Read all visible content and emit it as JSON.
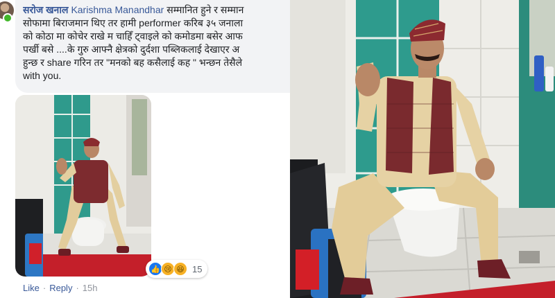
{
  "comment": {
    "author": "सरोज खनाल",
    "mention": "Karishma Manandhar",
    "lines": [
      "सम्मानित हुने र सम्मान",
      "सोफामा बिराजमान थिए तर हामी performer करिब ३५ जनाला",
      "को कोठा मा कोचेर राखे म चाहिँ ट्वाइले को कमोडमा बसेर आफ",
      "पर्खी बसे ....के गुरु आफ्नै क्षेत्रको दुर्दशा पब्लिकलाई देखाएर अ",
      "हुन्छ र share गरिन तर \"मनको बह कसैलाई कह \" भन्छन तेसैले",
      "with you."
    ]
  },
  "reactions": {
    "icons": [
      "like-icon",
      "sad-icon",
      "haha-icon"
    ],
    "glyphs": [
      "👍",
      "😢",
      "😆"
    ],
    "count": "15"
  },
  "actions": {
    "like": "Like",
    "reply": "Reply",
    "separator": "·",
    "time": "15h"
  },
  "colors": {
    "link": "#385898",
    "bubble": "#f2f3f5",
    "tile_teal": "#2e9b8d",
    "wall_white": "#eeeeea",
    "carpet_red": "#c41f2a"
  }
}
